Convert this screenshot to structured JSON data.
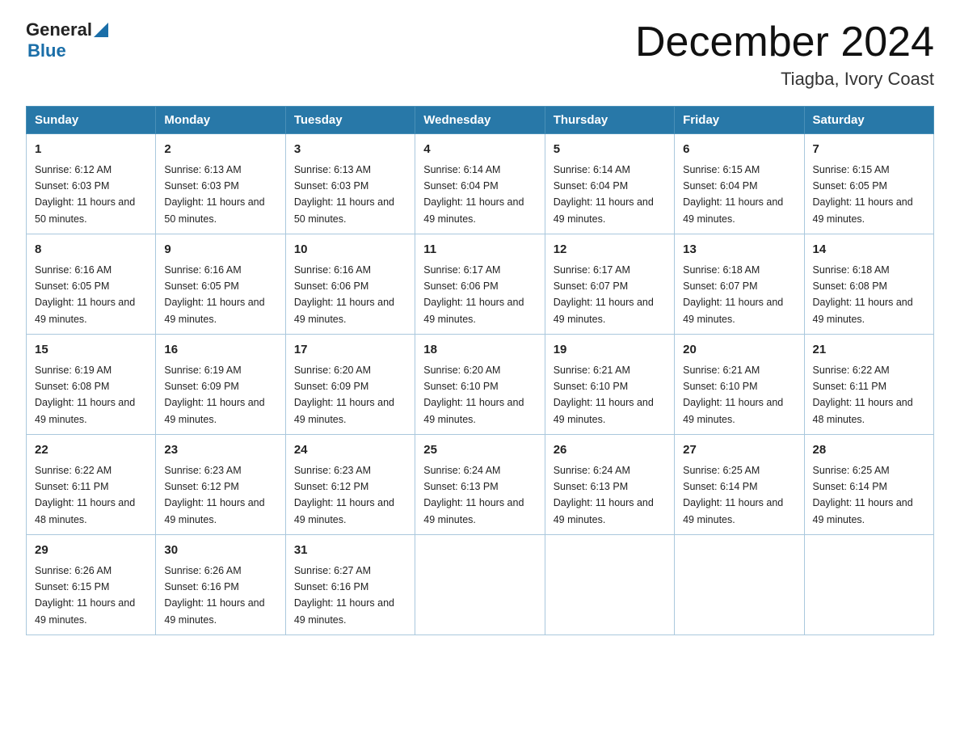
{
  "logo": {
    "general": "General",
    "blue": "Blue"
  },
  "title": {
    "month": "December 2024",
    "location": "Tiagba, Ivory Coast"
  },
  "weekdays": [
    "Sunday",
    "Monday",
    "Tuesday",
    "Wednesday",
    "Thursday",
    "Friday",
    "Saturday"
  ],
  "weeks": [
    [
      {
        "day": "1",
        "sunrise": "6:12 AM",
        "sunset": "6:03 PM",
        "daylight": "11 hours and 50 minutes."
      },
      {
        "day": "2",
        "sunrise": "6:13 AM",
        "sunset": "6:03 PM",
        "daylight": "11 hours and 50 minutes."
      },
      {
        "day": "3",
        "sunrise": "6:13 AM",
        "sunset": "6:03 PM",
        "daylight": "11 hours and 50 minutes."
      },
      {
        "day": "4",
        "sunrise": "6:14 AM",
        "sunset": "6:04 PM",
        "daylight": "11 hours and 49 minutes."
      },
      {
        "day": "5",
        "sunrise": "6:14 AM",
        "sunset": "6:04 PM",
        "daylight": "11 hours and 49 minutes."
      },
      {
        "day": "6",
        "sunrise": "6:15 AM",
        "sunset": "6:04 PM",
        "daylight": "11 hours and 49 minutes."
      },
      {
        "day": "7",
        "sunrise": "6:15 AM",
        "sunset": "6:05 PM",
        "daylight": "11 hours and 49 minutes."
      }
    ],
    [
      {
        "day": "8",
        "sunrise": "6:16 AM",
        "sunset": "6:05 PM",
        "daylight": "11 hours and 49 minutes."
      },
      {
        "day": "9",
        "sunrise": "6:16 AM",
        "sunset": "6:05 PM",
        "daylight": "11 hours and 49 minutes."
      },
      {
        "day": "10",
        "sunrise": "6:16 AM",
        "sunset": "6:06 PM",
        "daylight": "11 hours and 49 minutes."
      },
      {
        "day": "11",
        "sunrise": "6:17 AM",
        "sunset": "6:06 PM",
        "daylight": "11 hours and 49 minutes."
      },
      {
        "day": "12",
        "sunrise": "6:17 AM",
        "sunset": "6:07 PM",
        "daylight": "11 hours and 49 minutes."
      },
      {
        "day": "13",
        "sunrise": "6:18 AM",
        "sunset": "6:07 PM",
        "daylight": "11 hours and 49 minutes."
      },
      {
        "day": "14",
        "sunrise": "6:18 AM",
        "sunset": "6:08 PM",
        "daylight": "11 hours and 49 minutes."
      }
    ],
    [
      {
        "day": "15",
        "sunrise": "6:19 AM",
        "sunset": "6:08 PM",
        "daylight": "11 hours and 49 minutes."
      },
      {
        "day": "16",
        "sunrise": "6:19 AM",
        "sunset": "6:09 PM",
        "daylight": "11 hours and 49 minutes."
      },
      {
        "day": "17",
        "sunrise": "6:20 AM",
        "sunset": "6:09 PM",
        "daylight": "11 hours and 49 minutes."
      },
      {
        "day": "18",
        "sunrise": "6:20 AM",
        "sunset": "6:10 PM",
        "daylight": "11 hours and 49 minutes."
      },
      {
        "day": "19",
        "sunrise": "6:21 AM",
        "sunset": "6:10 PM",
        "daylight": "11 hours and 49 minutes."
      },
      {
        "day": "20",
        "sunrise": "6:21 AM",
        "sunset": "6:10 PM",
        "daylight": "11 hours and 49 minutes."
      },
      {
        "day": "21",
        "sunrise": "6:22 AM",
        "sunset": "6:11 PM",
        "daylight": "11 hours and 48 minutes."
      }
    ],
    [
      {
        "day": "22",
        "sunrise": "6:22 AM",
        "sunset": "6:11 PM",
        "daylight": "11 hours and 48 minutes."
      },
      {
        "day": "23",
        "sunrise": "6:23 AM",
        "sunset": "6:12 PM",
        "daylight": "11 hours and 49 minutes."
      },
      {
        "day": "24",
        "sunrise": "6:23 AM",
        "sunset": "6:12 PM",
        "daylight": "11 hours and 49 minutes."
      },
      {
        "day": "25",
        "sunrise": "6:24 AM",
        "sunset": "6:13 PM",
        "daylight": "11 hours and 49 minutes."
      },
      {
        "day": "26",
        "sunrise": "6:24 AM",
        "sunset": "6:13 PM",
        "daylight": "11 hours and 49 minutes."
      },
      {
        "day": "27",
        "sunrise": "6:25 AM",
        "sunset": "6:14 PM",
        "daylight": "11 hours and 49 minutes."
      },
      {
        "day": "28",
        "sunrise": "6:25 AM",
        "sunset": "6:14 PM",
        "daylight": "11 hours and 49 minutes."
      }
    ],
    [
      {
        "day": "29",
        "sunrise": "6:26 AM",
        "sunset": "6:15 PM",
        "daylight": "11 hours and 49 minutes."
      },
      {
        "day": "30",
        "sunrise": "6:26 AM",
        "sunset": "6:16 PM",
        "daylight": "11 hours and 49 minutes."
      },
      {
        "day": "31",
        "sunrise": "6:27 AM",
        "sunset": "6:16 PM",
        "daylight": "11 hours and 49 minutes."
      },
      null,
      null,
      null,
      null
    ]
  ]
}
